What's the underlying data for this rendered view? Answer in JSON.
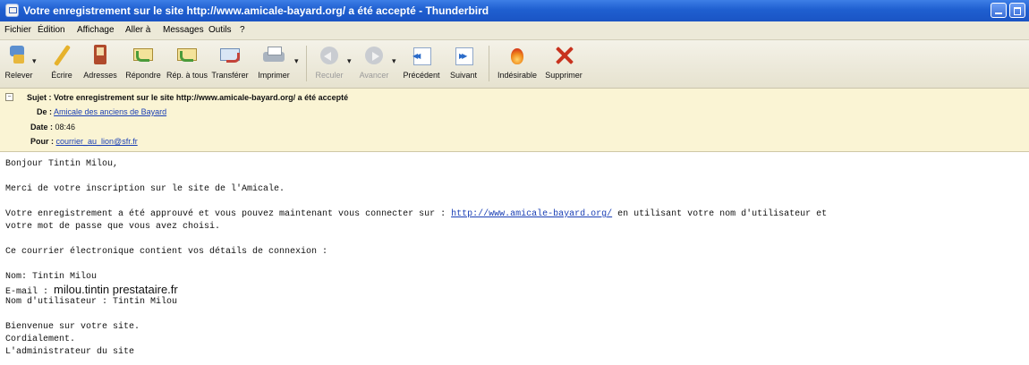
{
  "window": {
    "title": "Votre enregistrement sur le site http://www.amicale-bayard.org/ a été accepté - Thunderbird"
  },
  "menu": [
    "Fichier",
    "Édition",
    "Affichage",
    "Aller à",
    "Messages",
    "Outils",
    "?"
  ],
  "toolbar": {
    "get": "Relever",
    "write": "Écrire",
    "addressbook": "Adresses",
    "reply": "Répondre",
    "reply_all": "Rép. à tous",
    "forward": "Transférer",
    "print": "Imprimer",
    "back": "Reculer",
    "forward_nav": "Avancer",
    "previous": "Précédent",
    "next": "Suivant",
    "junk": "Indésirable",
    "delete": "Supprimer"
  },
  "header": {
    "subject_label": "Sujet :",
    "subject": "Votre enregistrement sur le site http://www.amicale-bayard.org/ a été accepté",
    "from_label": "De :",
    "from": "Amicale des anciens de Bayard",
    "date_label": "Date :",
    "date": "08:46",
    "to_label": "Pour :",
    "to": "courrier_au_lion@sfr.fr"
  },
  "body": {
    "greeting": "Bonjour Tintin Milou,",
    "thanks": "Merci de votre inscription sur le site de l'Amicale.",
    "approved_prefix": "Votre enregistrement a été approuvé et vous pouvez maintenant vous connecter sur : ",
    "approved_link": "http://www.amicale-bayard.org/",
    "approved_suffix": " en utilisant votre nom d'utilisateur et",
    "approved_line2": "votre mot de passe que vous avez choisi.",
    "details_intro": "Ce courrier électronique contient vos détails de connexion :",
    "name_line": "Nom:  Tintin Milou",
    "email_label": "E-mail : ",
    "email_value": "milou.tintin  prestataire.fr",
    "username_line": "Nom d'utilisateur : Tintin Milou",
    "welcome": "Bienvenue sur votre site.",
    "regards": "Cordialement.",
    "signature": "L'administrateur du site"
  }
}
